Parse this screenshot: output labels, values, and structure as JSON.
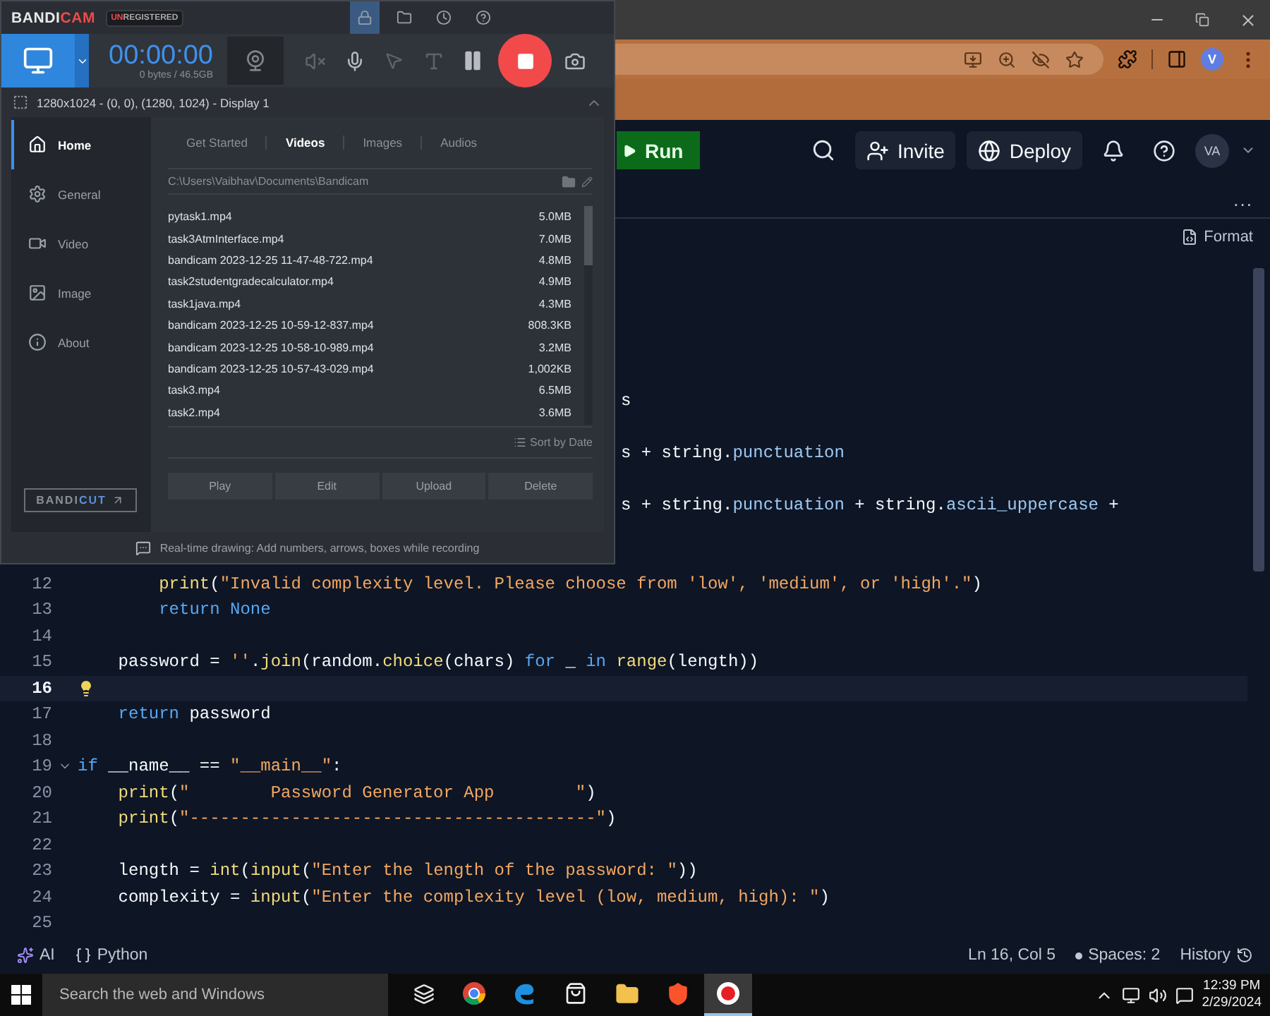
{
  "browser": {
    "profile": "V"
  },
  "replit_header": {
    "run": "Run",
    "invite": "Invite",
    "deploy": "Deploy",
    "avatar": "VA"
  },
  "tab_bar": {
    "more": "..."
  },
  "editor_toolbar": {
    "format": "Format"
  },
  "editor": {
    "lines": [
      {
        "kind": "covered",
        "tokens": [
          {
            "t": "s",
            "kind": "plain"
          }
        ]
      },
      {
        "kind": "covered",
        "tokens": [
          {
            "t": "s + string.",
            "kind": "plain"
          },
          {
            "t": "punctuation",
            "kind": "attribute"
          }
        ]
      },
      {
        "kind": "covered",
        "tokens": [
          {
            "t": "s + string.",
            "kind": "plain"
          },
          {
            "t": "punctuation",
            "kind": "attribute"
          },
          {
            "t": " + string.",
            "kind": "plain"
          },
          {
            "t": "ascii_uppercase",
            "kind": "attribute"
          },
          {
            "t": " +",
            "kind": "plain"
          }
        ]
      },
      {
        "kind": "code",
        "number": "12",
        "current": false,
        "tokens": [
          {
            "t": "        print",
            "kind": "function"
          },
          {
            "t": "(",
            "kind": "plain"
          },
          {
            "t": "\"Invalid complexity level. Please choose from 'low', 'medium', or 'high'.\"",
            "kind": "string"
          },
          {
            "t": ")",
            "kind": "plain"
          }
        ]
      },
      {
        "kind": "code",
        "number": "13",
        "current": false,
        "tokens": [
          {
            "t": "        return None",
            "kind": "keyword"
          }
        ]
      },
      {
        "kind": "code",
        "number": "14",
        "current": false
      },
      {
        "kind": "code",
        "number": "15",
        "current": false,
        "tokens": [
          {
            "t": "    password = ",
            "kind": "plain"
          },
          {
            "t": "''",
            "kind": "string"
          },
          {
            "t": ".",
            "kind": "plain"
          },
          {
            "t": "join",
            "kind": "function"
          },
          {
            "t": "(random.",
            "kind": "plain"
          },
          {
            "t": "choice",
            "kind": "function"
          },
          {
            "t": "(chars) ",
            "kind": "plain"
          },
          {
            "t": "for",
            "kind": "keyword"
          },
          {
            "t": " _ ",
            "kind": "plain"
          },
          {
            "t": "in ",
            "kind": "keyword"
          },
          {
            "t": "range",
            "kind": "function"
          },
          {
            "t": "(length))",
            "kind": "plain"
          }
        ]
      },
      {
        "kind": "code",
        "number": "16",
        "current": true,
        "bulb": true
      },
      {
        "kind": "code",
        "number": "17",
        "current": false,
        "tokens": [
          {
            "t": "    return",
            "kind": "keyword"
          },
          {
            "t": " password",
            "kind": "plain"
          }
        ]
      },
      {
        "kind": "code",
        "number": "18",
        "current": false
      },
      {
        "kind": "code",
        "number": "19",
        "current": false,
        "fold": true,
        "tokens": [
          {
            "t": "if",
            "kind": "keyword"
          },
          {
            "t": " __name__ == ",
            "kind": "plain"
          },
          {
            "t": "\"__main__\"",
            "kind": "string"
          },
          {
            "t": ":",
            "kind": "plain"
          }
        ]
      },
      {
        "kind": "code",
        "number": "20",
        "current": false,
        "tokens": [
          {
            "t": "    print",
            "kind": "function"
          },
          {
            "t": "(",
            "kind": "plain"
          },
          {
            "t": "\"        Password Generator App        \"",
            "kind": "string"
          },
          {
            "t": ")",
            "kind": "plain"
          }
        ]
      },
      {
        "kind": "code",
        "number": "21",
        "current": false,
        "tokens": [
          {
            "t": "    print",
            "kind": "function"
          },
          {
            "t": "(",
            "kind": "plain"
          },
          {
            "t": "\"----------------------------------------\"",
            "kind": "string"
          },
          {
            "t": ")",
            "kind": "plain"
          }
        ]
      },
      {
        "kind": "code",
        "number": "22",
        "current": false
      },
      {
        "kind": "code",
        "number": "23",
        "current": false,
        "tokens": [
          {
            "t": "    length = ",
            "kind": "plain"
          },
          {
            "t": "int",
            "kind": "function"
          },
          {
            "t": "(",
            "kind": "plain"
          },
          {
            "t": "input",
            "kind": "function"
          },
          {
            "t": "(",
            "kind": "plain"
          },
          {
            "t": "\"Enter the length of the password: \"",
            "kind": "string"
          },
          {
            "t": "))",
            "kind": "plain"
          }
        ]
      },
      {
        "kind": "code",
        "number": "24",
        "current": false,
        "tokens": [
          {
            "t": "    complexity = ",
            "kind": "plain"
          },
          {
            "t": "input",
            "kind": "function"
          },
          {
            "t": "(",
            "kind": "plain"
          },
          {
            "t": "\"Enter the complexity level (low, medium, high): \"",
            "kind": "string"
          },
          {
            "t": ")",
            "kind": "plain"
          }
        ]
      },
      {
        "kind": "code",
        "number": "25",
        "current": false
      }
    ]
  },
  "status_bar": {
    "ai": "AI",
    "language": "Python",
    "cursor": "Ln 16, Col 5",
    "spaces": "Spaces: 2",
    "history": "History"
  },
  "taskbar": {
    "search_placeholder": "Search the web and Windows",
    "time": "12:39 PM",
    "date": "2/29/2024",
    "apps": [
      {
        "kind": "taskview",
        "active": false
      },
      {
        "kind": "chrome",
        "active": false
      },
      {
        "kind": "edge",
        "active": false
      },
      {
        "kind": "store",
        "active": false
      },
      {
        "kind": "explorer",
        "active": false
      },
      {
        "kind": "brave",
        "active": false
      },
      {
        "kind": "bandicam",
        "active": true
      }
    ]
  },
  "bandicam": {
    "logo_a": "BANDI",
    "logo_b": "CAM",
    "badge_a": "UN",
    "badge_b": "REGISTERED",
    "top_icons": [
      {
        "kind": "lock",
        "selected": true
      },
      {
        "kind": "folder",
        "selected": false
      },
      {
        "kind": "clock",
        "selected": false
      },
      {
        "kind": "help",
        "selected": false
      }
    ],
    "timer": "00:00:00",
    "storage": "0 bytes / 46.5GB",
    "area": "1280x1024 - (0, 0), (1280, 1024) - Display 1",
    "sidebar": [
      {
        "kind": "home",
        "label": "Home",
        "selected": true
      },
      {
        "kind": "general",
        "label": "General",
        "selected": false
      },
      {
        "kind": "video",
        "label": "Video",
        "selected": false
      },
      {
        "kind": "image",
        "label": "Image",
        "selected": false
      },
      {
        "kind": "about",
        "label": "About",
        "selected": false
      }
    ],
    "bandicut_a": "BANDI",
    "bandicut_b": "CUT",
    "tabs": [
      {
        "label": "Get Started",
        "selected": false
      },
      {
        "label": "Videos",
        "selected": true
      },
      {
        "label": "Images",
        "selected": false
      },
      {
        "label": "Audios",
        "selected": false
      }
    ],
    "path": "C:\\Users\\Vaibhav\\Documents\\Bandicam",
    "files": [
      {
        "name": "pytask1.mp4",
        "size": "5.0MB"
      },
      {
        "name": "task3AtmInterface.mp4",
        "size": "7.0MB"
      },
      {
        "name": "bandicam 2023-12-25 11-47-48-722.mp4",
        "size": "4.8MB"
      },
      {
        "name": "task2studentgradecalculator.mp4",
        "size": "4.9MB"
      },
      {
        "name": "task1java.mp4",
        "size": "4.3MB"
      },
      {
        "name": "bandicam 2023-12-25 10-59-12-837.mp4",
        "size": "808.3KB"
      },
      {
        "name": "bandicam 2023-12-25 10-58-10-989.mp4",
        "size": "3.2MB"
      },
      {
        "name": "bandicam 2023-12-25 10-57-43-029.mp4",
        "size": "1,002KB"
      },
      {
        "name": "task3.mp4",
        "size": "6.5MB"
      },
      {
        "name": "task2.mp4",
        "size": "3.6MB"
      }
    ],
    "sort": "Sort by Date",
    "actions": [
      "Play",
      "Edit",
      "Upload",
      "Delete"
    ],
    "tip": "Real-time drawing: Add numbers, arrows, boxes while recording"
  }
}
